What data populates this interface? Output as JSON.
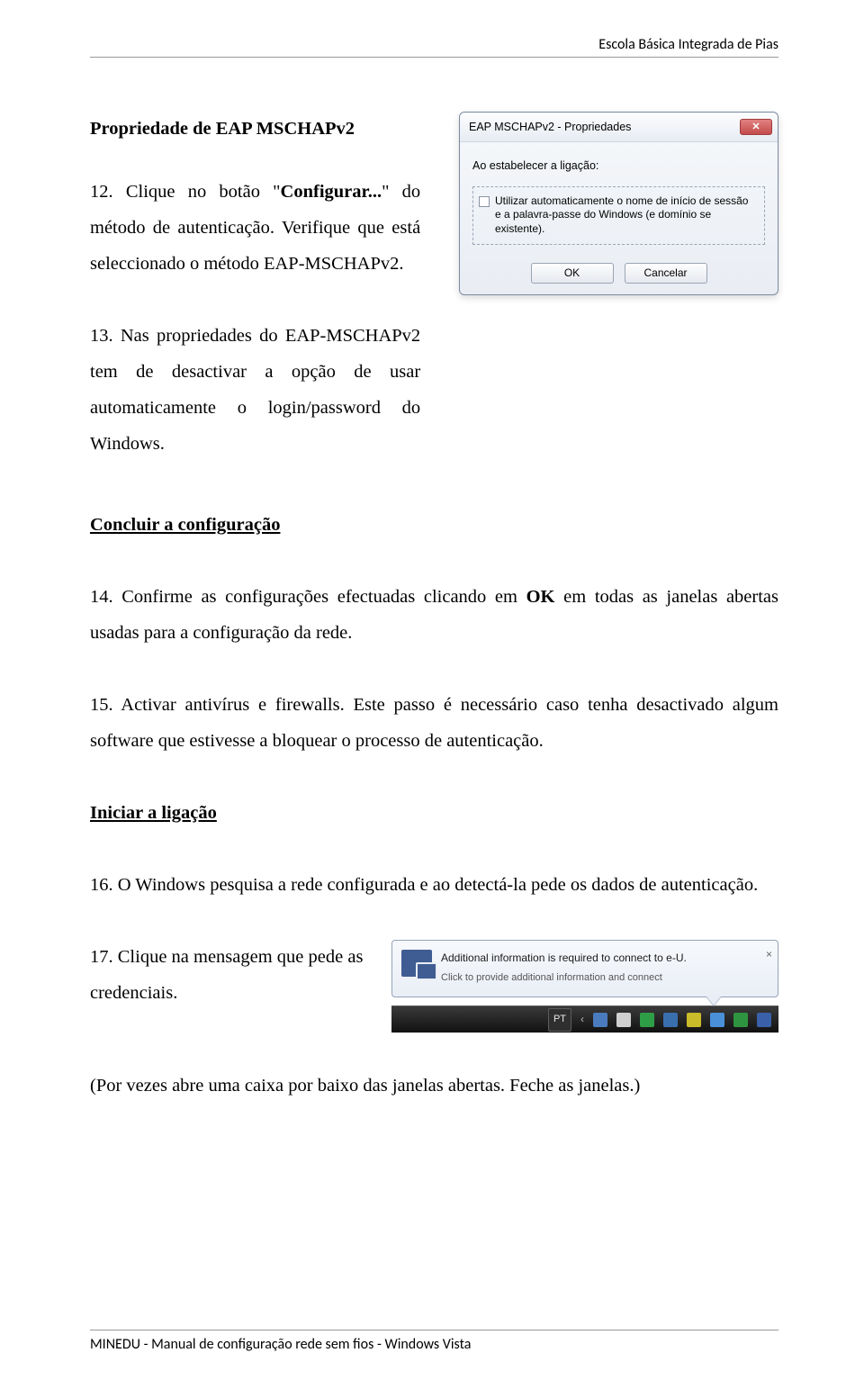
{
  "header": {
    "school": "Escola Básica Integrada de Pias"
  },
  "sections": {
    "prop_title": "Propriedade de EAP MSCHAPv2",
    "p12_prefix": "12. Clique no botão \"",
    "p12_bold": "Configurar...",
    "p12_suffix": "\" do método de autenticação. Verifique que está seleccionado o método EAP-MSCHAPv2.",
    "p13": "13. Nas propriedades do EAP-MSCHAPv2 tem de desactivar a opção de usar automaticamente o login/password do Windows.",
    "concluir": "Concluir a configuração",
    "p14_prefix": "14. Confirme as configurações efectuadas clicando em ",
    "p14_bold": "OK",
    "p14_suffix": " em todas as janelas abertas usadas para a configuração da rede.",
    "p15": "15. Activar antivírus e firewalls. Este passo é necessário caso tenha desactivado algum software que estivesse a bloquear o processo de autenticação.",
    "iniciar": "Iniciar a ligação",
    "p16": "16. O Windows pesquisa a rede configurada e ao detectá-la pede os dados de autenticação.",
    "p17": "17. Clique na mensagem que pede as credenciais.",
    "p_final": "(Por vezes abre uma caixa por baixo das janelas abertas. Feche as janelas.)"
  },
  "dialog": {
    "title": "EAP MSCHAPv2 - Propriedades",
    "body_label": "Ao estabelecer a ligação:",
    "checkbox_label": "Utilizar automaticamente o nome de início de sessão e a palavra-passe do Windows (e domínio se existente).",
    "ok": "OK",
    "cancel": "Cancelar",
    "close_glyph": "✕"
  },
  "notification": {
    "title": "Additional information is required to connect to e-U.",
    "subtitle": "Click to provide additional information and connect",
    "close_glyph": "×"
  },
  "taskbar": {
    "lang": "PT",
    "arrow": "‹"
  },
  "footer": {
    "text": "MINEDU - Manual de configuração rede sem fios - Windows Vista"
  }
}
